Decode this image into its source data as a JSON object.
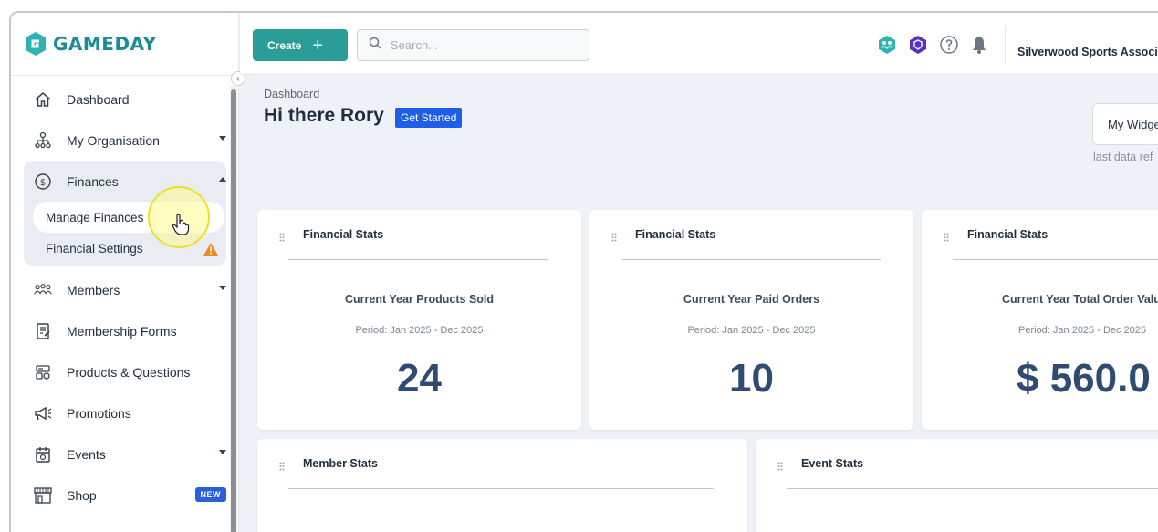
{
  "app": {
    "brand": "GAMEDAY",
    "brand_color": "#1b8c94",
    "accent_color": "#2a9d98"
  },
  "topbar": {
    "create_label": "Create",
    "search_placeholder": "Search...",
    "icons": [
      "team-icon",
      "shield-icon",
      "help-icon",
      "bell-icon"
    ],
    "org_name": "Silverwood Sports Associ"
  },
  "sidebar": {
    "items": [
      {
        "label": "Dashboard",
        "icon": "home-icon"
      },
      {
        "label": "My Organisation",
        "icon": "org-chart-icon",
        "expandable": true
      },
      {
        "label": "Finances",
        "icon": "dollar-circle-icon",
        "expanded": true,
        "children": [
          {
            "label": "Manage Finances",
            "active": true
          },
          {
            "label": "Financial Settings",
            "warning": true
          }
        ]
      },
      {
        "label": "Members",
        "icon": "members-icon",
        "expandable": true
      },
      {
        "label": "Membership Forms",
        "icon": "form-icon"
      },
      {
        "label": "Products & Questions",
        "icon": "products-icon"
      },
      {
        "label": "Promotions",
        "icon": "megaphone-icon"
      },
      {
        "label": "Events",
        "icon": "calendar-icon",
        "expandable": true
      },
      {
        "label": "Shop",
        "icon": "shop-icon",
        "badge": "NEW"
      }
    ]
  },
  "main": {
    "breadcrumb": "Dashboard",
    "greeting": "Hi there Rory",
    "get_started": "Get Started",
    "widget_button": "My Widge",
    "last_refresh": "last data ref",
    "stat_cards": [
      {
        "title": "Financial Stats",
        "label": "Current Year Products Sold",
        "period": "Period: Jan 2025 - Dec 2025",
        "value": "24"
      },
      {
        "title": "Financial Stats",
        "label": "Current Year Paid Orders",
        "period": "Period: Jan 2025 - Dec 2025",
        "value": "10"
      },
      {
        "title": "Financial Stats",
        "label": "Current Year Total Order Valu",
        "period": "Period: Jan 2025 - Dec 2025",
        "value": "$ 560.0"
      }
    ],
    "lower_cards": [
      {
        "title": "Member Stats"
      },
      {
        "title": "Event Stats"
      }
    ]
  }
}
